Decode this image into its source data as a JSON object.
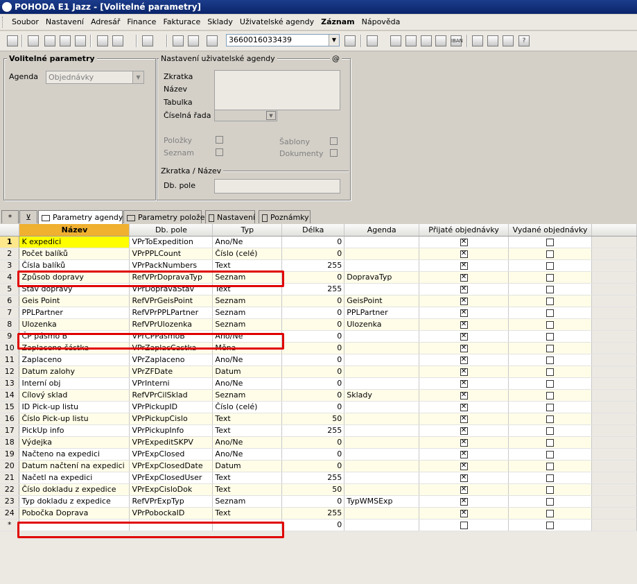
{
  "window": {
    "title": "POHODA E1 Jazz - [Volitelné parametry]"
  },
  "menu": [
    "Soubor",
    "Nastavení",
    "Adresář",
    "Finance",
    "Fakturace",
    "Sklady",
    "Uživatelské agendy",
    "Záznam",
    "Nápověda"
  ],
  "toolbar": {
    "combo_value": "3660016033439"
  },
  "left_panel": {
    "title": "Volitelné parametry",
    "agenda_label": "Agenda",
    "agenda_value": "Objednávky"
  },
  "user_agenda": {
    "title": "Nastavení uživatelské agendy",
    "at_symbol": "@",
    "labels": [
      "Zkratka",
      "Název",
      "Tabulka",
      "Číselná řada"
    ],
    "checks": {
      "polozky": "Položky",
      "seznam": "Seznam",
      "sablony": "Šablony",
      "dokumenty": "Dokumenty"
    },
    "sub_title": "Zkratka / Název",
    "db_label": "Db. pole"
  },
  "tabs": {
    "asterisk": "*",
    "t1": "Parametry agendy",
    "t2": "Parametry položek",
    "t3": "Nastavení",
    "t4": "Poznámky"
  },
  "grid": {
    "columns": [
      "Název",
      "Db. pole",
      "Typ",
      "Délka",
      "Agenda",
      "Přijaté objednávky",
      "Vydané objednávky"
    ],
    "rows": [
      {
        "n": "1",
        "name": "K expedici",
        "db": "VPrToExpedition",
        "typ": "Ano/Ne",
        "len": "0",
        "agenda": "",
        "p": true,
        "v": false
      },
      {
        "n": "2",
        "name": "Počet balíků",
        "db": "VPrPPLCount",
        "typ": "Číslo (celé)",
        "len": "0",
        "agenda": "",
        "p": true,
        "v": false
      },
      {
        "n": "3",
        "name": "Čísla balíků",
        "db": "VPrPackNumbers",
        "typ": "Text",
        "len": "255",
        "agenda": "",
        "p": true,
        "v": false
      },
      {
        "n": "4",
        "name": "Způsob dopravy",
        "db": "RefVPrDopravaTyp",
        "typ": "Seznam",
        "len": "0",
        "agenda": "DopravaTyp",
        "p": true,
        "v": false
      },
      {
        "n": "5",
        "name": "Stav dopravy",
        "db": "VPrDopravaStav",
        "typ": "Text",
        "len": "255",
        "agenda": "",
        "p": true,
        "v": false
      },
      {
        "n": "6",
        "name": "Geis Point",
        "db": "RefVPrGeisPoint",
        "typ": "Seznam",
        "len": "0",
        "agenda": "GeisPoint",
        "p": true,
        "v": false
      },
      {
        "n": "7",
        "name": "PPLPartner",
        "db": "RefVPrPPLPartner",
        "typ": "Seznam",
        "len": "0",
        "agenda": "PPLPartner",
        "p": true,
        "v": false
      },
      {
        "n": "8",
        "name": "Ulozenka",
        "db": "RefVPrUlozenka",
        "typ": "Seznam",
        "len": "0",
        "agenda": "Ulozenka",
        "p": true,
        "v": false
      },
      {
        "n": "9",
        "name": "ČP pásmo B",
        "db": "VPrCPPasmoB",
        "typ": "Ano/Ne",
        "len": "0",
        "agenda": "",
        "p": true,
        "v": false
      },
      {
        "n": "10",
        "name": "Zaplaceno částka",
        "db": "VPrZaplacCastka",
        "typ": "Měna",
        "len": "0",
        "agenda": "",
        "p": true,
        "v": false
      },
      {
        "n": "11",
        "name": "Zaplaceno",
        "db": "VPrZaplaceno",
        "typ": "Ano/Ne",
        "len": "0",
        "agenda": "",
        "p": true,
        "v": false
      },
      {
        "n": "12",
        "name": "Datum zalohy",
        "db": "VPrZFDate",
        "typ": "Datum",
        "len": "0",
        "agenda": "",
        "p": true,
        "v": false
      },
      {
        "n": "13",
        "name": "Interní obj",
        "db": "VPrInterni",
        "typ": "Ano/Ne",
        "len": "0",
        "agenda": "",
        "p": true,
        "v": false
      },
      {
        "n": "14",
        "name": "Cílový sklad",
        "db": "RefVPrCilSklad",
        "typ": "Seznam",
        "len": "0",
        "agenda": "Sklady",
        "p": true,
        "v": false
      },
      {
        "n": "15",
        "name": "ID Pick-up listu",
        "db": "VPrPickupID",
        "typ": "Číslo (celé)",
        "len": "0",
        "agenda": "",
        "p": true,
        "v": false
      },
      {
        "n": "16",
        "name": "Číslo Pick-up listu",
        "db": "VPrPickupCislo",
        "typ": "Text",
        "len": "50",
        "agenda": "",
        "p": true,
        "v": false
      },
      {
        "n": "17",
        "name": "PickUp info",
        "db": "VPrPickupInfo",
        "typ": "Text",
        "len": "255",
        "agenda": "",
        "p": true,
        "v": false
      },
      {
        "n": "18",
        "name": "Výdejka",
        "db": "VPrExpeditSKPV",
        "typ": "Ano/Ne",
        "len": "0",
        "agenda": "",
        "p": true,
        "v": false
      },
      {
        "n": "19",
        "name": "Načteno na expedici",
        "db": "VPrExpClosed",
        "typ": "Ano/Ne",
        "len": "0",
        "agenda": "",
        "p": true,
        "v": false
      },
      {
        "n": "20",
        "name": "Datum načtení na expedici",
        "db": "VPrExpClosedDate",
        "typ": "Datum",
        "len": "0",
        "agenda": "",
        "p": true,
        "v": false
      },
      {
        "n": "21",
        "name": "Načetl na expedici",
        "db": "VPrExpClosedUser",
        "typ": "Text",
        "len": "255",
        "agenda": "",
        "p": true,
        "v": false
      },
      {
        "n": "22",
        "name": "Číslo dokladu z expedice",
        "db": "VPrExpCisloDok",
        "typ": "Text",
        "len": "50",
        "agenda": "",
        "p": true,
        "v": false
      },
      {
        "n": "23",
        "name": "Typ dokladu z expedice",
        "db": "RefVPrExpTyp",
        "typ": "Seznam",
        "len": "0",
        "agenda": "TypWMSExp",
        "p": true,
        "v": false
      },
      {
        "n": "24",
        "name": "Pobočka Doprava",
        "db": "VPrPobockaID",
        "typ": "Text",
        "len": "255",
        "agenda": "",
        "p": true,
        "v": false
      },
      {
        "n": "*",
        "name": "",
        "db": "",
        "typ": "",
        "len": "0",
        "agenda": "",
        "p": false,
        "v": false
      }
    ]
  },
  "colors": {
    "highlight": "#e00000",
    "selected_cell": "#ffff00",
    "header_active": "#f0b030"
  }
}
